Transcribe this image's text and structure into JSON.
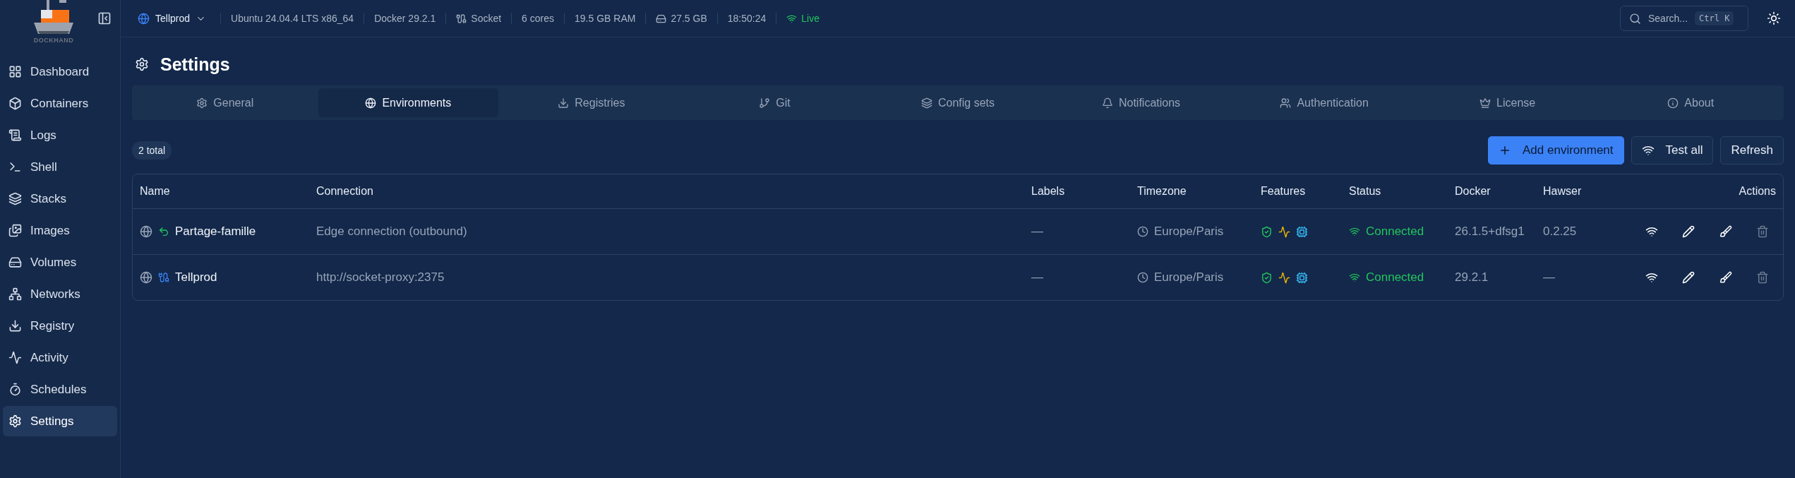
{
  "brand": {
    "name": "DOCKHAND"
  },
  "sidebar": {
    "items": [
      {
        "label": "Dashboard",
        "selected": false
      },
      {
        "label": "Containers",
        "selected": false
      },
      {
        "label": "Logs",
        "selected": false
      },
      {
        "label": "Shell",
        "selected": false
      },
      {
        "label": "Stacks",
        "selected": false
      },
      {
        "label": "Images",
        "selected": false
      },
      {
        "label": "Volumes",
        "selected": false
      },
      {
        "label": "Networks",
        "selected": false
      },
      {
        "label": "Registry",
        "selected": false
      },
      {
        "label": "Activity",
        "selected": false
      },
      {
        "label": "Schedules",
        "selected": false
      },
      {
        "label": "Settings",
        "selected": true
      }
    ]
  },
  "topbar": {
    "environment": "Tellprod",
    "info": [
      {
        "kind": "text",
        "text": "Ubuntu 24.04.4 LTS x86_64"
      },
      {
        "kind": "text",
        "text": "Docker 29.2.1"
      },
      {
        "kind": "socket",
        "text": "Socket"
      },
      {
        "kind": "text",
        "text": "6 cores"
      },
      {
        "kind": "text",
        "text": "19.5 GB RAM"
      },
      {
        "kind": "disk",
        "text": "27.5 GB"
      },
      {
        "kind": "text",
        "text": "18:50:24"
      },
      {
        "kind": "live",
        "text": "Live"
      }
    ],
    "search": {
      "placeholder": "Search...",
      "keys": [
        "Ctrl",
        "K"
      ]
    }
  },
  "page": {
    "title": "Settings"
  },
  "tabs": [
    {
      "label": "General",
      "selected": false
    },
    {
      "label": "Environments",
      "selected": true
    },
    {
      "label": "Registries",
      "selected": false
    },
    {
      "label": "Git",
      "selected": false
    },
    {
      "label": "Config sets",
      "selected": false
    },
    {
      "label": "Notifications",
      "selected": false
    },
    {
      "label": "Authentication",
      "selected": false
    },
    {
      "label": "License",
      "selected": false
    },
    {
      "label": "About",
      "selected": false
    }
  ],
  "count": "2 total",
  "buttons": [
    {
      "kind": "primary",
      "label": "Add environment"
    },
    {
      "kind": "test",
      "label": "Test all"
    },
    {
      "kind": "plain",
      "label": "Refresh"
    }
  ],
  "table": {
    "columns": [
      "Name",
      "Connection",
      "Labels",
      "Timezone",
      "Features",
      "Status",
      "Docker",
      "Hawser",
      "Actions"
    ],
    "rows": [
      {
        "kind": "edge",
        "name": "Partage-famille",
        "connection": "Edge connection (outbound)",
        "labels": "—",
        "timezone": "Europe/Paris",
        "status": "Connected",
        "docker": "26.1.5+dfsg1",
        "hawser": "0.2.25"
      },
      {
        "kind": "socket",
        "name": "Tellprod",
        "connection": "http://socket-proxy:2375",
        "labels": "—",
        "timezone": "Europe/Paris",
        "status": "Connected",
        "docker": "29.2.1",
        "hawser": "—"
      }
    ]
  }
}
